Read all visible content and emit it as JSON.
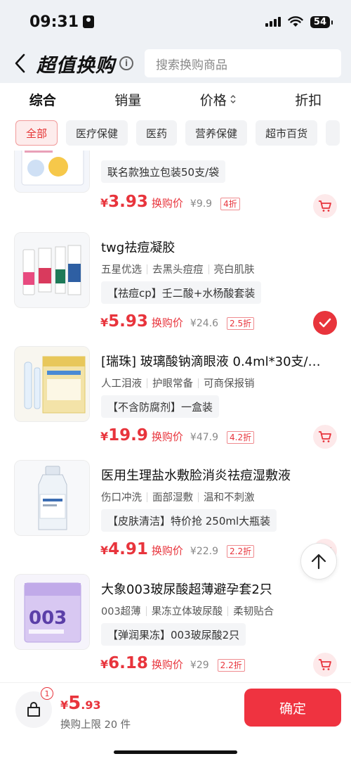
{
  "status_bar": {
    "time": "09:31",
    "battery": "54"
  },
  "header": {
    "title": "超值换购",
    "info_glyph": "i",
    "search_placeholder": "搜索换购商品"
  },
  "sort_tabs": [
    {
      "label": "综合"
    },
    {
      "label": "销量"
    },
    {
      "label": "价格"
    },
    {
      "label": "折扣"
    }
  ],
  "categories": [
    "全部",
    "医疗保健",
    "医药",
    "营养保健",
    "超市百货"
  ],
  "products": [
    {
      "title": "",
      "tags": [],
      "promo": "联名款独立包装50支/袋",
      "price_int": "3",
      "price_dec": ".93",
      "price_label": "换购价",
      "original": "¥9.9",
      "discount": "4折",
      "selected": false
    },
    {
      "title": "twg祛痘凝胶",
      "tags": [
        "五星优选",
        "去黑头痘痘",
        "亮白肌肤"
      ],
      "promo": "【祛痘cp】壬二酸+水杨酸套装",
      "price_int": "5",
      "price_dec": ".93",
      "price_label": "换购价",
      "original": "¥24.6",
      "discount": "2.5折",
      "selected": true
    },
    {
      "title": "[瑞珠] 玻璃酸钠滴眼液 0.4ml*30支/…",
      "tags": [
        "人工泪液",
        "护眼常备",
        "可商保报销"
      ],
      "promo": "【不含防腐剂】一盒装",
      "price_int": "19",
      "price_dec": ".9",
      "price_label": "换购价",
      "original": "¥47.9",
      "discount": "4.2折",
      "selected": false
    },
    {
      "title": "医用生理盐水敷脸消炎祛痘湿敷液",
      "tags": [
        "伤口冲洗",
        "面部湿敷",
        "温和不刺激"
      ],
      "promo": "【皮肤清洁】特价抢 250ml大瓶装",
      "price_int": "4",
      "price_dec": ".91",
      "price_label": "换购价",
      "original": "¥22.9",
      "discount": "2.2折",
      "selected": false
    },
    {
      "title": "大象003玻尿酸超薄避孕套2只",
      "tags": [
        "003超薄",
        "果冻立体玻尿酸",
        "柔韧贴合"
      ],
      "promo": "【弹润果冻】003玻尿酸2只",
      "price_int": "6",
      "price_dec": ".18",
      "price_label": "换购价",
      "original": "¥29",
      "discount": "2.2折",
      "selected": false
    }
  ],
  "bottom": {
    "badge_count": "1",
    "currency": "¥",
    "total_int": "5",
    "total_dec": ".93",
    "limit_text": "换购上限 20 件",
    "confirm_label": "确定"
  },
  "colors": {
    "accent": "#e8343c",
    "background": "#eef1f5"
  },
  "icons": [
    "person-icon",
    "wifi-icon",
    "back-icon",
    "info-icon",
    "cart-icon",
    "check-icon",
    "arrow-up-icon",
    "bag-icon"
  ]
}
